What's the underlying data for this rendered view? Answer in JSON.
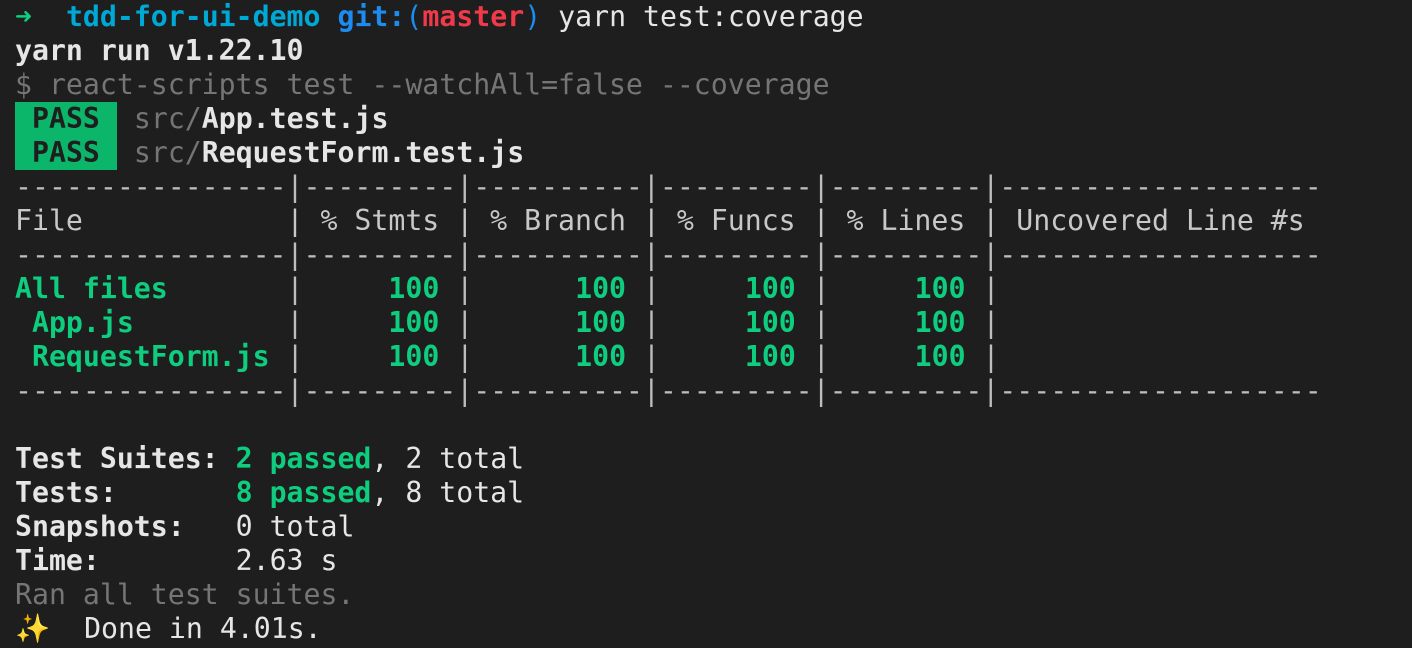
{
  "prompt": {
    "arrow": "➜",
    "directory": "tdd-for-ui-demo",
    "git_prefix": "git:",
    "paren_open": "(",
    "branch": "master",
    "paren_close": ")",
    "command": "yarn test:coverage"
  },
  "yarn_version_line": "yarn run v1.22.10",
  "script_line": "$ react-scripts test --watchAll=false --coverage",
  "test_results": [
    {
      "status": "PASS",
      "dir": "src/",
      "file": "App.test.js"
    },
    {
      "status": "PASS",
      "dir": "src/",
      "file": "RequestForm.test.js"
    }
  ],
  "coverage_table": {
    "separator": "----------------|---------|----------|---------|---------|-------------------",
    "header": "File            | % Stmts | % Branch | % Funcs | % Lines | Uncovered Line #s ",
    "rows": [
      {
        "name": "All files",
        "indent": "",
        "pad": "       ",
        "stmts": "100",
        "branch": "100",
        "funcs": "100",
        "lines": "100",
        "uncovered": ""
      },
      {
        "name": "App.js",
        "indent": " ",
        "pad": "         ",
        "stmts": "100",
        "branch": "100",
        "funcs": "100",
        "lines": "100",
        "uncovered": ""
      },
      {
        "name": "RequestForm.js",
        "indent": " ",
        "pad": " ",
        "stmts": "100",
        "branch": "100",
        "funcs": "100",
        "lines": "100",
        "uncovered": ""
      }
    ]
  },
  "summary": {
    "suites_label": "Test Suites:",
    "suites_passed": "2 passed",
    "suites_total": ", 2 total",
    "tests_label": "Tests:",
    "tests_passed": "8 passed",
    "tests_total": ", 8 total",
    "snapshots_label": "Snapshots:",
    "snapshots_value": "0 total",
    "time_label": "Time:",
    "time_value": "2.63 s",
    "ran_all": "Ran all test suites.",
    "sparkle_icon": "✨",
    "done": "Done in 4.01s."
  },
  "colors": {
    "background": "#1e1e1e",
    "pass_badge": "#0bb66a",
    "success_text": "#0fcd7e",
    "branch_red": "#f03a4a",
    "directory_cyan": "#00a8d6"
  }
}
